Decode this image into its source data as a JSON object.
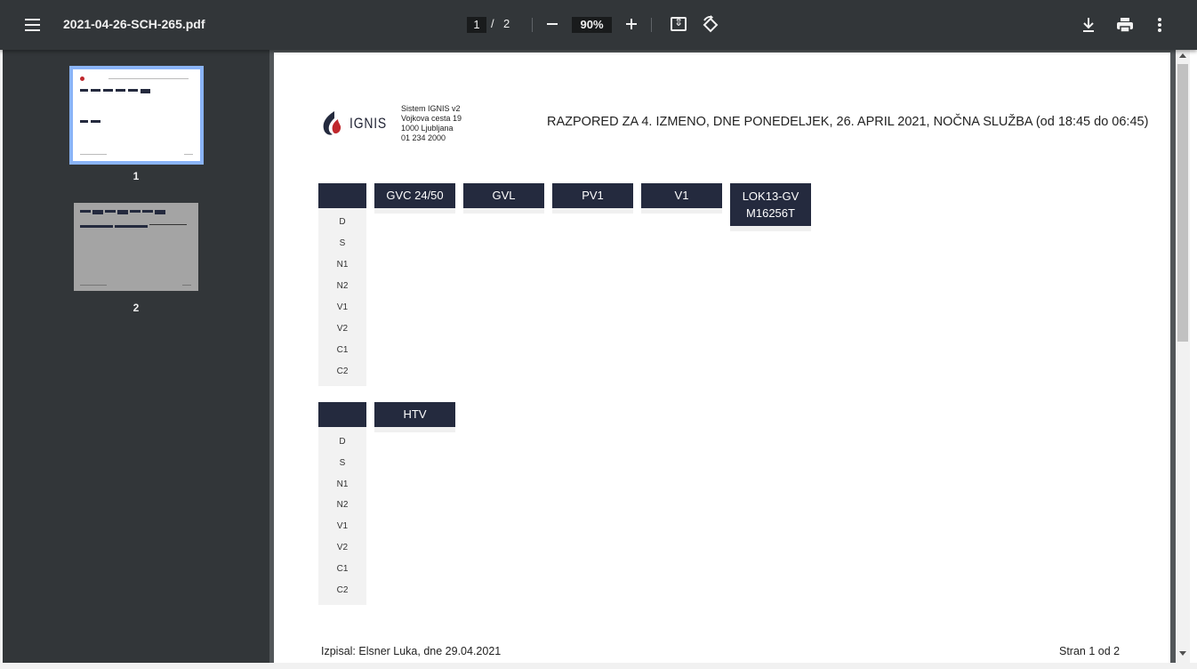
{
  "toolbar": {
    "filename": "2021-04-26-SCH-265.pdf",
    "current_page": "1",
    "page_separator": "/",
    "total_pages": "2",
    "zoom": "90%",
    "icons": [
      "menu-icon",
      "zoom-out-icon",
      "zoom-in-icon",
      "fit-to-page-icon",
      "rotate-icon",
      "download-icon",
      "print-icon",
      "more-vert-icon"
    ]
  },
  "sidebar": {
    "thumbnails": [
      {
        "label": "1",
        "selected": true
      },
      {
        "label": "2",
        "selected": false
      }
    ],
    "selected_color": "#8ab4f8"
  },
  "document": {
    "logo_text": "IGNIS",
    "address": {
      "line1": "Sistem IGNIS v2",
      "line2": "Vojkova cesta 19",
      "line3": "1000 Ljubljana",
      "line4": "01 234 2000"
    },
    "heading": "RAZPORED ZA 4. IZMENO, DNE PONEDELJEK, 26. APRIL 2021, NOČNA SLUŽBA (od 18:45 do 06:45)",
    "table1": {
      "row_labels": [
        "D",
        "S",
        "N1",
        "N2",
        "V1",
        "V2",
        "C1",
        "C2"
      ],
      "columns": [
        "GVC 24/50",
        "GVL",
        "PV1",
        "V1",
        "LOK13-GVM16256T"
      ]
    },
    "table2": {
      "row_labels": [
        "D",
        "S",
        "N1",
        "N2",
        "V1",
        "V2",
        "C1",
        "C2"
      ],
      "columns": [
        "HTV"
      ]
    },
    "footer_left": "Izpisal: Elsner Luka, dne 29.04.2021",
    "footer_right": "Stran 1 od 2",
    "header_color": "#242a3e",
    "logo_color": "#c0282d"
  }
}
